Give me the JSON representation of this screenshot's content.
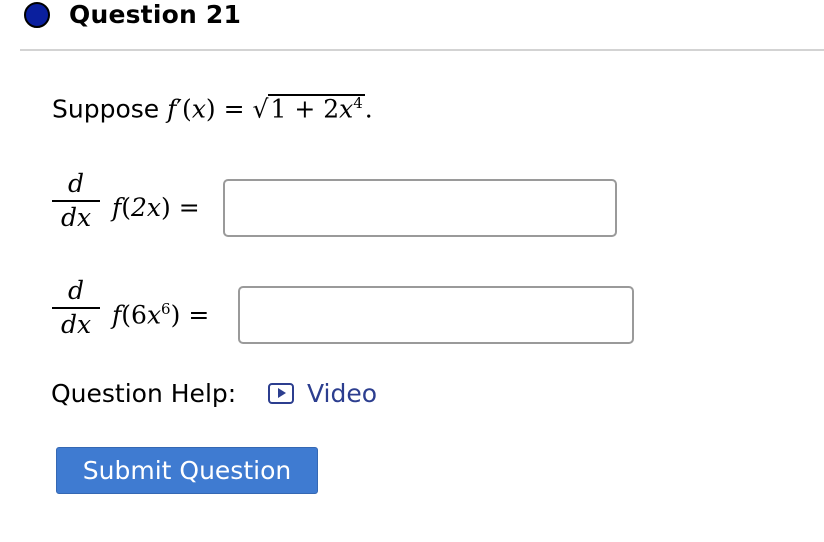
{
  "header": {
    "title": "Question 21"
  },
  "statement": {
    "prefix": "Suppose",
    "fn": "f",
    "var": "x",
    "equals": "=",
    "radicand_lead": "1 + 2",
    "exponent": "4",
    "end": "."
  },
  "part1": {
    "num": "d",
    "den": "dx",
    "fn": "f",
    "inner": "2x",
    "equals": "=",
    "answer": ""
  },
  "part2": {
    "num": "d",
    "den": "dx",
    "fn": "f",
    "inner_coef": "6",
    "inner_var": "x",
    "inner_exp": "6",
    "equals": "=",
    "answer": ""
  },
  "help": {
    "label": "Question Help:",
    "video_icon": "play-video-icon",
    "video_label": "Video"
  },
  "submit": {
    "label": "Submit Question"
  },
  "colors": {
    "status_dot": "#0a1f9e",
    "link": "#2c3e8f",
    "submit_bg": "#3f7bd1"
  }
}
